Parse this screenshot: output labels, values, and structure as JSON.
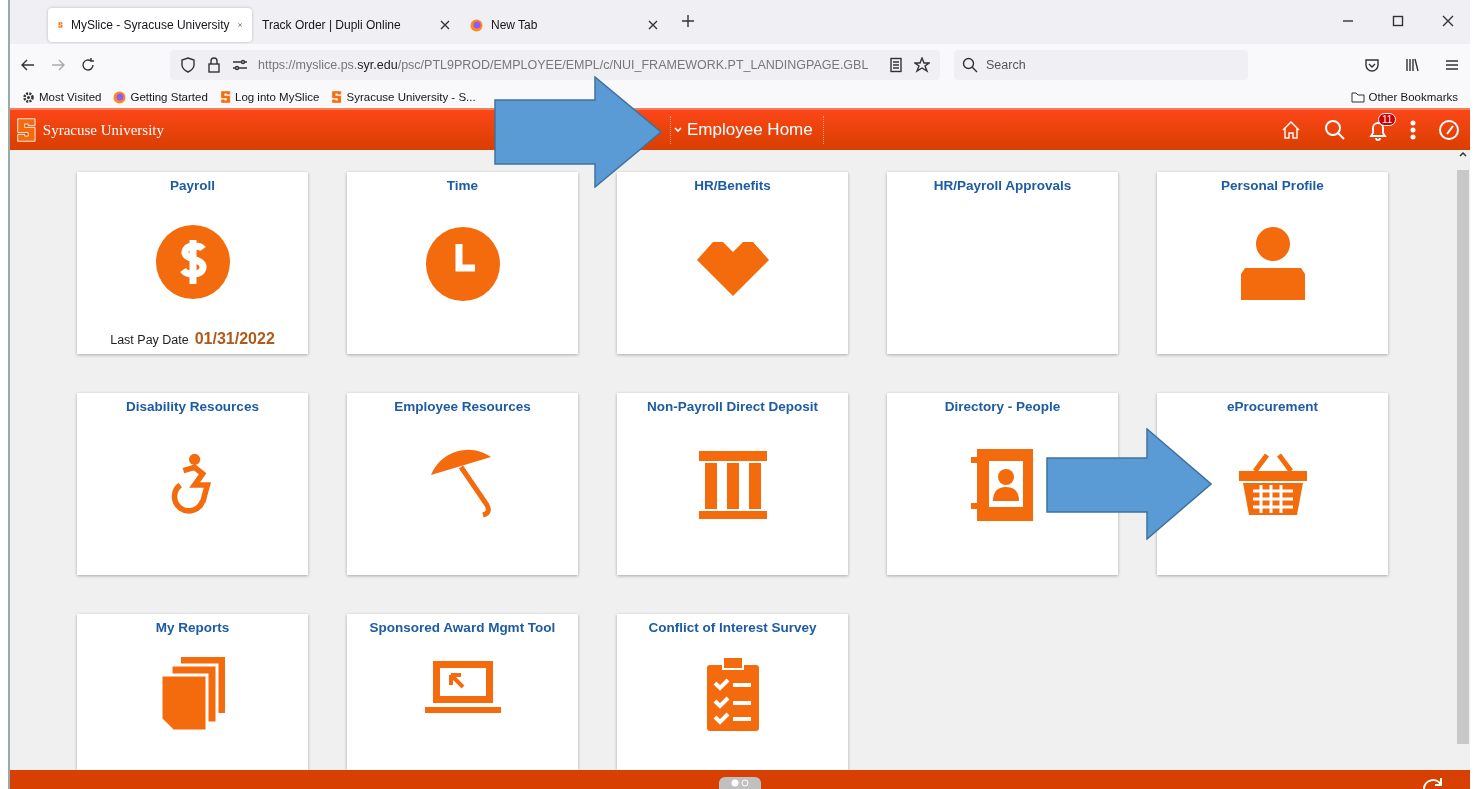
{
  "browser_tabs": [
    {
      "title": "MySlice - Syracuse University",
      "selected": true
    },
    {
      "title": "Track Order | Dupli Online",
      "selected": false
    },
    {
      "title": "New Tab",
      "selected": false
    }
  ],
  "address_bar": {
    "url": "https://myslice.ps.**syr.edu**/psc/PTL9PROD/EMPLOYEE/EMPL/c/NUI_FRAMEWORK.PT_LANDINGPAGE.GBL"
  },
  "search": {
    "placeholder": "Search"
  },
  "bookmarks": [
    {
      "label": "Most Visited"
    },
    {
      "label": "Getting Started"
    },
    {
      "label": "Log into MySlice"
    },
    {
      "label": "Syracuse University - S..."
    }
  ],
  "other_bookmarks": "Other Bookmarks",
  "header": {
    "brand": "Syracuse University",
    "title": "Employee Home",
    "notification_count": "11"
  },
  "tiles": [
    {
      "title": "Payroll",
      "kind": "dollar",
      "note": {
        "label": "Last Pay Date",
        "value": "01/31/2022"
      }
    },
    {
      "title": "Time",
      "kind": "clock"
    },
    {
      "title": "HR/Benefits",
      "kind": "heart"
    },
    {
      "title": "HR/Payroll Approvals",
      "kind": "none"
    },
    {
      "title": "Personal Profile",
      "kind": "person"
    },
    {
      "title": "Disability Resources",
      "kind": "wheelchair"
    },
    {
      "title": "Employee Resources",
      "kind": "umbrella"
    },
    {
      "title": "Non-Payroll Direct Deposit",
      "kind": "columns"
    },
    {
      "title": "Directory - People",
      "kind": "contacts"
    },
    {
      "title": "eProcurement",
      "kind": "basket"
    },
    {
      "title": "My Reports",
      "kind": "documents"
    },
    {
      "title": "Sponsored Award Mgmt Tool",
      "kind": "laptop"
    },
    {
      "title": "Conflict of Interest Survey",
      "kind": "clipboard"
    }
  ]
}
